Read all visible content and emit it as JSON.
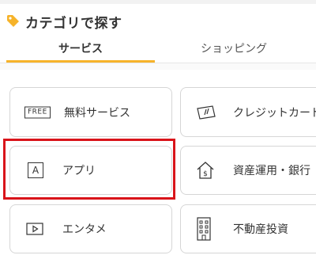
{
  "header": {
    "title": "カテゴリで探す",
    "icon": "tag-icon"
  },
  "tabs": [
    {
      "label": "サービス",
      "active": true
    },
    {
      "label": "ショッピング",
      "active": false
    }
  ],
  "cards": [
    {
      "label": "無料サービス",
      "icon": "free-badge-icon",
      "badge_text": "FREE"
    },
    {
      "label": "クレジットカード",
      "icon": "credit-card-icon"
    },
    {
      "label": "アプリ",
      "icon": "app-icon",
      "badge_text": "A"
    },
    {
      "label": "資産運用・銀行",
      "icon": "bank-house-icon"
    },
    {
      "label": "エンタメ",
      "icon": "play-icon"
    },
    {
      "label": "不動産投資",
      "icon": "building-icon"
    }
  ],
  "colors": {
    "accent": "#f6b32a",
    "highlight": "#d9141a"
  }
}
